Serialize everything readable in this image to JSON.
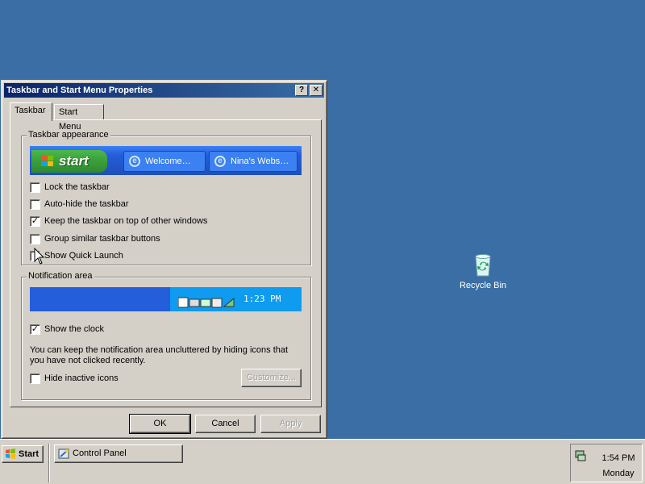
{
  "desktop": {
    "background_color": "#3a6ea5",
    "icons": [
      {
        "label": "Recycle Bin",
        "icon": "recycle-bin-icon"
      }
    ]
  },
  "dialog": {
    "title": "Taskbar and Start Menu Properties",
    "help_button": "?",
    "close_button": "✕",
    "tabs": [
      {
        "label": "Taskbar",
        "active": true
      },
      {
        "label": "Start Menu",
        "active": false
      }
    ],
    "appearance_group": {
      "legend": "Taskbar appearance",
      "preview": {
        "start_label": "start",
        "tasks": [
          "Welcome…",
          "Nina's Webs…"
        ]
      },
      "options": [
        {
          "label": "Lock the taskbar",
          "checked": false
        },
        {
          "label": "Auto-hide the taskbar",
          "checked": false
        },
        {
          "label": "Keep the taskbar on top of other windows",
          "checked": true
        },
        {
          "label": "Group similar taskbar buttons",
          "checked": false
        },
        {
          "label": "Show Quick Launch",
          "checked": false
        }
      ]
    },
    "notification_group": {
      "legend": "Notification area",
      "preview_time": "1:23 PM",
      "show_clock": {
        "label": "Show the clock",
        "checked": true
      },
      "description": "You can keep the notification area uncluttered by hiding icons that you have not clicked recently.",
      "hide_inactive": {
        "label": "Hide inactive icons",
        "checked": false
      },
      "customize_label": "Customize..."
    },
    "buttons": {
      "ok": "OK",
      "cancel": "Cancel",
      "apply": "Apply"
    }
  },
  "taskbar": {
    "start_label": "Start",
    "tasks": [
      {
        "label": "Control Panel",
        "icon": "control-panel-icon"
      }
    ],
    "clock_time": "1:54 PM",
    "clock_day": "Monday"
  }
}
